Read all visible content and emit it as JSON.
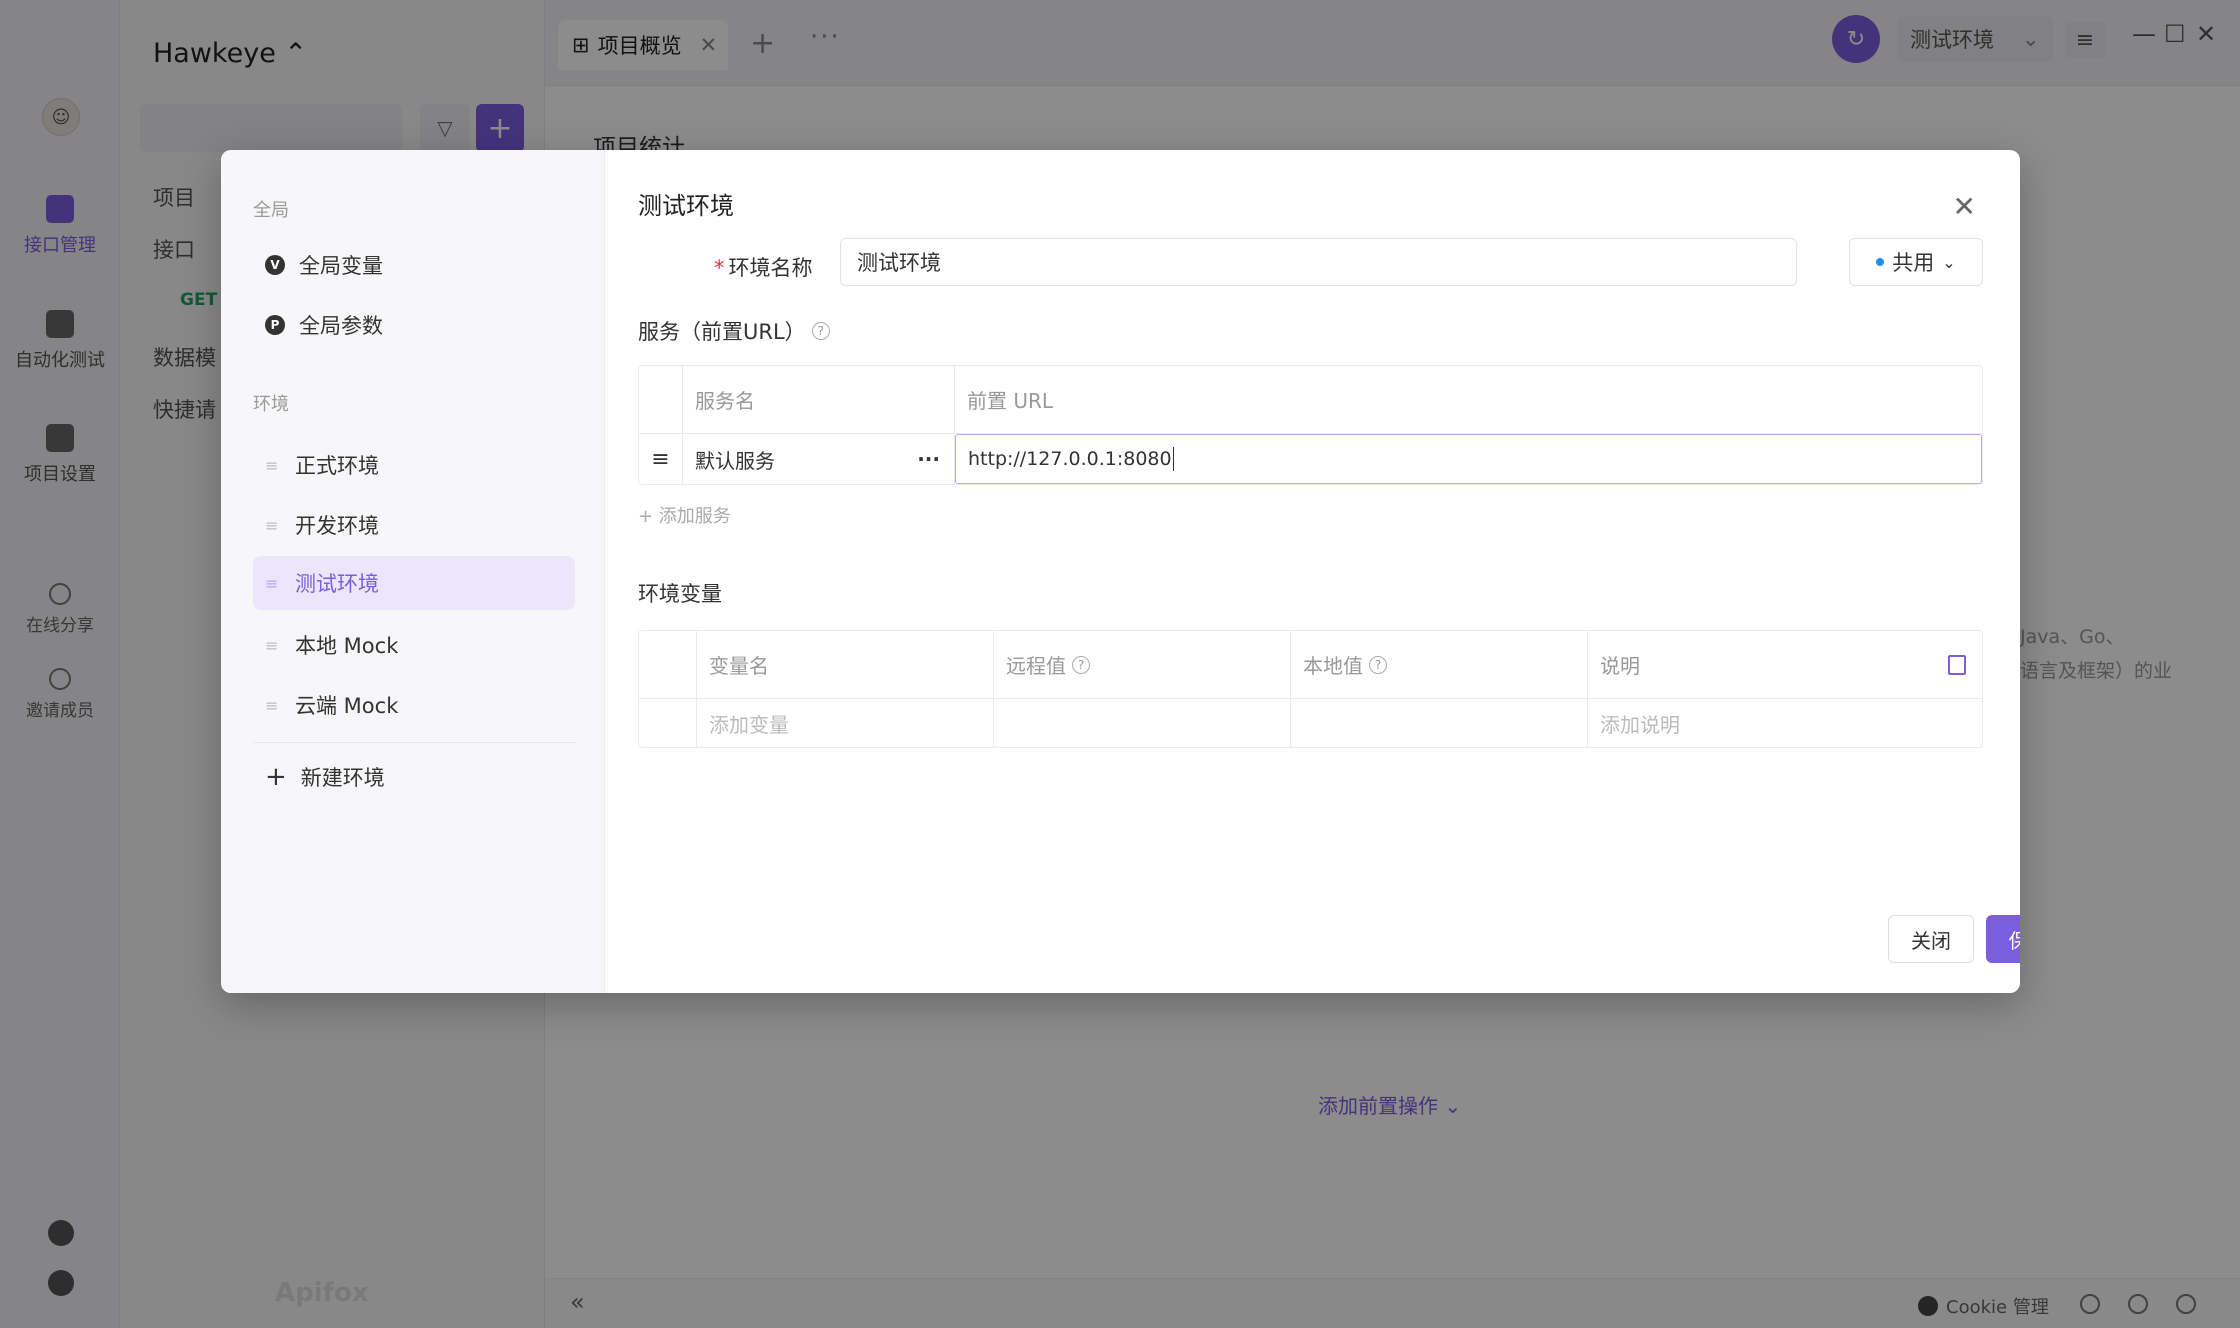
{
  "app": {
    "project_name": "Hawkeye",
    "brand": "Apifox",
    "accent_color": "#7b5ee0"
  },
  "rail": {
    "items": [
      {
        "label": "接口管理",
        "icon": "api-management-icon",
        "active": true
      },
      {
        "label": "自动化测试",
        "icon": "automation-test-icon"
      },
      {
        "label": "项目设置",
        "icon": "project-settings-icon"
      },
      {
        "label": "在线分享",
        "icon": "share-icon"
      },
      {
        "label": "邀请成员",
        "icon": "invite-member-icon"
      }
    ]
  },
  "project_panel": {
    "tree_items": [
      "项目",
      "接口",
      "GET",
      "数据模",
      "快捷请"
    ]
  },
  "topbar": {
    "active_tab": "项目概览",
    "current_env": "测试环境"
  },
  "main": {
    "heading": "项目统计",
    "bg_line1": "Java、Go、",
    "bg_line2": "语言及框架）的业",
    "bg_link": "添加前置操作"
  },
  "statusbar": {
    "cookie": "Cookie 管理"
  },
  "modal": {
    "sidebar": {
      "global_group": "全局",
      "global_items": [
        {
          "label": "全局变量",
          "badge": "V"
        },
        {
          "label": "全局参数",
          "badge": "P"
        }
      ],
      "env_group": "环境",
      "env_items": [
        "正式环境",
        "开发环境",
        "测试环境",
        "本地 Mock",
        "云端 Mock"
      ],
      "active_env": "测试环境",
      "new_env": "新建环境"
    },
    "title": "测试环境",
    "env_name_label": "环境名称",
    "env_name_value": "测试环境",
    "share_label": "共用",
    "services": {
      "title": "服务（前置URL）",
      "col_name": "服务名",
      "col_url": "前置 URL",
      "rows": [
        {
          "name": "默认服务",
          "url": "http://127.0.0.1:8080"
        }
      ],
      "add": "+ 添加服务"
    },
    "vars": {
      "title": "环境变量",
      "col_name": "变量名",
      "col_remote": "远程值",
      "col_local": "本地值",
      "col_desc": "说明",
      "add_var_placeholder": "添加变量",
      "add_desc_placeholder": "添加说明"
    },
    "close_label": "关闭",
    "save_label": "保存"
  }
}
